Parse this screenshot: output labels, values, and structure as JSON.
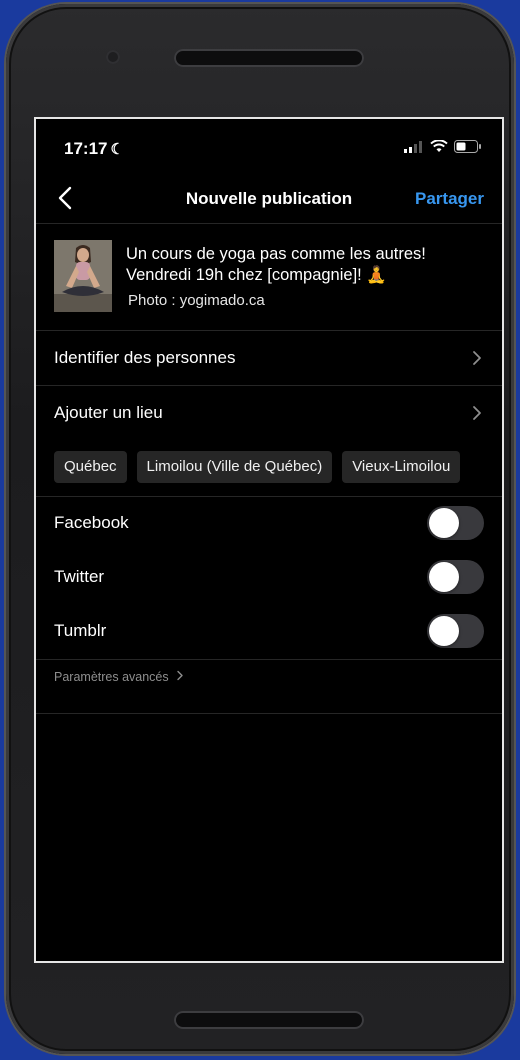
{
  "status_bar": {
    "time": "17:17",
    "moon_icon": "moon-icon",
    "signal_icon": "signal-icon",
    "wifi_icon": "wifi-icon",
    "battery_icon": "battery-icon"
  },
  "header": {
    "back_icon": "chevron-left-icon",
    "title": "Nouvelle publication",
    "share_label": "Partager"
  },
  "post": {
    "caption_line1": "Un cours de yoga pas comme les autres!",
    "caption_line2": "Vendredi 19h chez [compagnie]! 🧘",
    "credit": "Photo : yogimado.ca"
  },
  "options": [
    {
      "label": "Identifier des personnes"
    },
    {
      "label": "Ajouter un lieu"
    }
  ],
  "location_suggestions": [
    "Québec",
    "Limoilou (Ville de Québec)",
    "Vieux-Limoilou"
  ],
  "share_toggles": [
    {
      "label": "Facebook",
      "on": false
    },
    {
      "label": "Twitter",
      "on": false
    },
    {
      "label": "Tumblr",
      "on": false
    }
  ],
  "advanced_label": "Paramètres avancés",
  "colors": {
    "accent": "#3897f0",
    "background": "#000000",
    "toggle_off": "#39393d",
    "outer_background": "#1a3a9e"
  }
}
